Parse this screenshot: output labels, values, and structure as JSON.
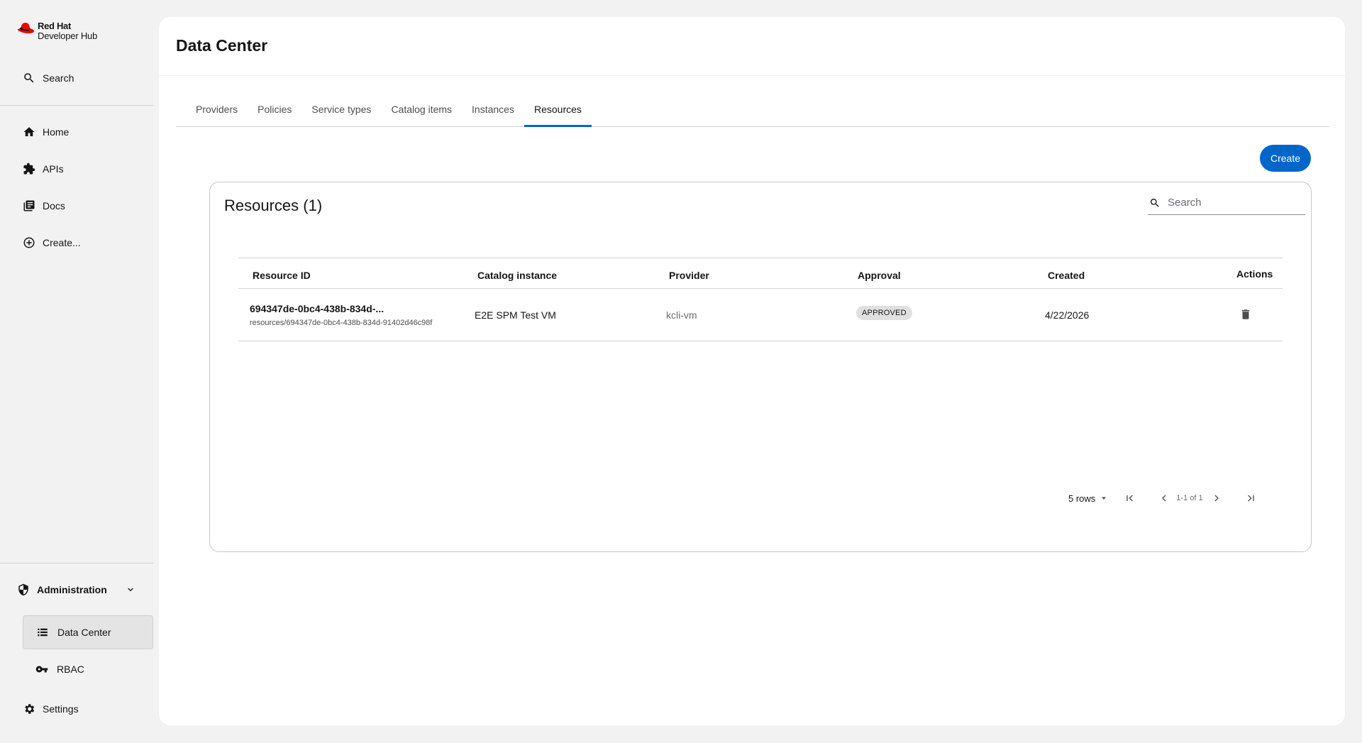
{
  "brand": {
    "line1": "Red Hat",
    "line2": "Developer Hub",
    "logo_color": "#ee0000"
  },
  "sidebar": {
    "search_label": "Search",
    "items": [
      {
        "label": "Home",
        "icon": "home-icon"
      },
      {
        "label": "APIs",
        "icon": "puzzle-icon"
      },
      {
        "label": "Docs",
        "icon": "docs-icon"
      },
      {
        "label": "Create...",
        "icon": "add-circle-icon"
      }
    ],
    "admin": {
      "label": "Administration",
      "sub_items": [
        {
          "label": "Data Center",
          "icon": "list-icon",
          "active": true
        },
        {
          "label": "RBAC",
          "icon": "key-icon",
          "active": false
        }
      ]
    },
    "settings_label": "Settings"
  },
  "page": {
    "title": "Data Center"
  },
  "tabs": [
    {
      "label": "Providers"
    },
    {
      "label": "Policies"
    },
    {
      "label": "Service types"
    },
    {
      "label": "Catalog items"
    },
    {
      "label": "Instances"
    },
    {
      "label": "Resources",
      "active": true
    }
  ],
  "create_label": "Create",
  "accent_color": "#0066cc",
  "panel": {
    "title": "Resources (1)",
    "search_placeholder": "Search"
  },
  "table": {
    "headers": [
      "Resource ID",
      "Catalog instance",
      "Provider",
      "Approval",
      "Created",
      "Actions"
    ],
    "rows": [
      {
        "resource_id": "694347de-0bc4-438b-834d-...",
        "resource_path": "resources/694347de-0bc4-438b-834d-91402d46c98f",
        "catalog_instance": "E2E SPM Test VM",
        "provider": "kcli-vm",
        "approval": "APPROVED",
        "created": "4/22/2026"
      }
    ]
  },
  "pagination": {
    "rows_label": "5 rows",
    "range": "1-1 of 1"
  }
}
